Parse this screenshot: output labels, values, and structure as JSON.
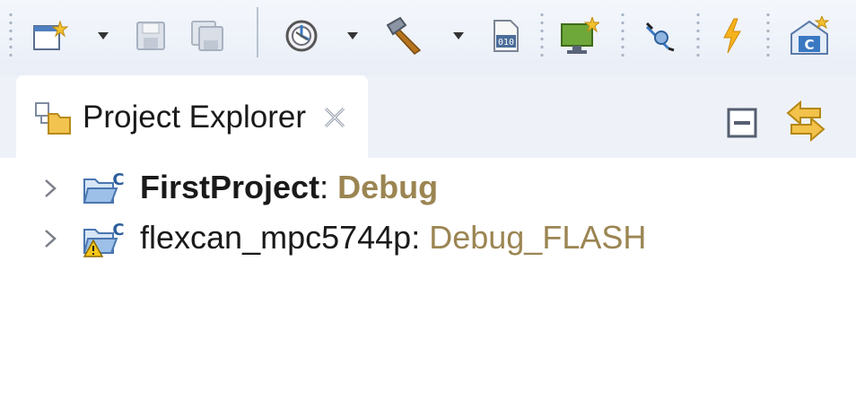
{
  "toolbar": {
    "buttons": [
      {
        "name": "new-file-icon"
      },
      {
        "name": "dropdown-arrow-icon"
      },
      {
        "name": "save-icon"
      },
      {
        "name": "save-all-icon"
      },
      {
        "name": "build-settings-icon"
      },
      {
        "name": "dropdown-arrow-icon"
      },
      {
        "name": "build-hammer-icon"
      },
      {
        "name": "dropdown-arrow-icon"
      },
      {
        "name": "binary-file-icon"
      },
      {
        "name": "monitor-icon"
      },
      {
        "name": "debug-probe-icon"
      },
      {
        "name": "lightning-icon"
      },
      {
        "name": "new-c-class-icon"
      }
    ],
    "colors": {
      "accent_green": "#6ea83a",
      "accent_orange": "#e8a21c",
      "accent_blue": "#3a78c2"
    }
  },
  "view": {
    "tab_label": "Project Explorer",
    "tab_icon": "project-explorer-icon",
    "close_icon": "close-icon",
    "actions": [
      {
        "name": "collapse-all-icon"
      },
      {
        "name": "link-with-editor-icon"
      }
    ]
  },
  "tree": {
    "items": [
      {
        "name": "FirstProject",
        "separator": ": ",
        "config": "Debug",
        "bold": true,
        "icon": "c-project-folder-icon",
        "expander": "chevron-right-icon"
      },
      {
        "name": "flexcan_mpc5744p",
        "separator": ": ",
        "config": "Debug_FLASH",
        "bold": false,
        "icon": "c-project-warning-icon",
        "expander": "chevron-right-icon"
      }
    ],
    "config_color": "#9b8552"
  }
}
